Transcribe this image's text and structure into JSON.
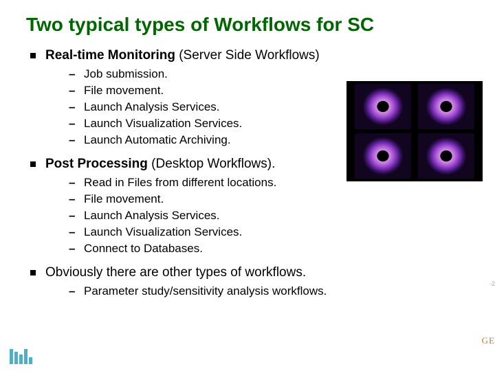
{
  "title": "Two typical types of Workflows for SC",
  "bullets": [
    {
      "label_bold": "Real-time Monitoring",
      "label_rest": " (Server Side Workflows)",
      "sub": [
        "Job submission.",
        "File movement.",
        "Launch Analysis Services.",
        "Launch Visualization Services.",
        "Launch Automatic Archiving."
      ]
    },
    {
      "label_bold": "Post Processing",
      "label_rest": " (Desktop Workflows).",
      "sub": [
        "Read in Files from different locations.",
        "File movement.",
        "Launch Analysis Services.",
        "Launch Visualization Services.",
        "Connect to Databases."
      ]
    },
    {
      "label_bold": "",
      "label_rest": "Obviously there are other types of workflows.",
      "sub": [
        "Parameter study/sensitivity analysis workflows."
      ]
    }
  ],
  "edge_num": "-2",
  "edge_ge": "GE"
}
